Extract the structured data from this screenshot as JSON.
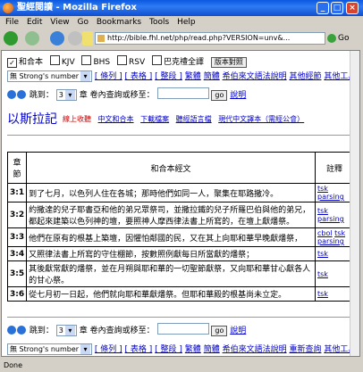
{
  "window": {
    "title": "聖經閱讀 - Mozilla Firefox"
  },
  "menu": [
    "File",
    "Edit",
    "View",
    "Go",
    "Bookmarks",
    "Tools",
    "Help"
  ],
  "address": {
    "url": "http://bible.fhl.net/php/read.php?VERSION=unv&...",
    "go_label": "Go"
  },
  "versions": [
    {
      "label": "和合本",
      "checked": true
    },
    {
      "label": "KJV",
      "checked": false
    },
    {
      "label": "BHS",
      "checked": false
    },
    {
      "label": "RSV",
      "checked": false
    },
    {
      "label": "巴克禮全譯",
      "checked": false
    }
  ],
  "version_button": "版本對照",
  "strong_select": "無 Strong's number",
  "links_top": [
    "[ 條列 ]",
    "[ 表格 ]",
    "[ 整段 ]",
    "繁體",
    "簡體",
    "希伯來文語法說明",
    "其他經節",
    "其他工具"
  ],
  "jump": {
    "prefix": "跳到：",
    "chapter": "3",
    "chapter_suffix": "章",
    "search_label": "卷內查詢或移至：",
    "go": "go",
    "help": "說明"
  },
  "book": {
    "title": "以斯拉記",
    "extra_red": "線上收聽",
    "extras": [
      "中文和合本",
      "下載檔案",
      "聽經語言檔",
      "現代中文譯本（需經公會）"
    ]
  },
  "table": {
    "headers": [
      "章節",
      "和合本經文",
      "註釋"
    ],
    "rows": [
      {
        "ref": "3:1",
        "text": "到了七月，以色列人住在各城；那時他們如同一人，聚集在耶路撒冷。",
        "notes": [
          "tsk",
          "parsing"
        ]
      },
      {
        "ref": "3:2",
        "text": "約撒達的兒子耶書亞和他的弟兄眾祭司，並撒拉鐵的兒子所羅巴伯與他的弟兄，都起來建築以色列神的壇，要照神人摩西律法書上所寫的，在壇上獻燔祭。",
        "notes": [
          "tsk",
          "parsing"
        ]
      },
      {
        "ref": "3:3",
        "text": "他們在原有的根基上築壇，因懼怕鄰國的民，又在其上向耶和華早晚獻燔祭，",
        "notes": [
          "cbol",
          "tsk",
          "parsing"
        ]
      },
      {
        "ref": "3:4",
        "text": "又照律法書上所寫的守住棚節，按數照例獻每日所當獻的燔祭；",
        "notes": [
          "tsk"
        ]
      },
      {
        "ref": "3:5",
        "text": "其後獻常獻的燔祭，並在月朔與耶和華的一切聖節獻祭，又向耶和華甘心獻各人的甘心祭。",
        "notes": [
          "tsk"
        ]
      },
      {
        "ref": "3:6",
        "text": "從七月初一日起，他們就向耶和華獻燔祭。但耶和華殿的根基尚未立定。",
        "notes": [
          "tsk"
        ]
      }
    ]
  },
  "links_bottom": [
    "[ 條列 ]",
    "[ 表格 ]",
    "[ 整段 ]",
    "繁體",
    "簡體",
    "希伯來文語法說明",
    "重新查詢",
    "其他工具"
  ],
  "status": "Done"
}
